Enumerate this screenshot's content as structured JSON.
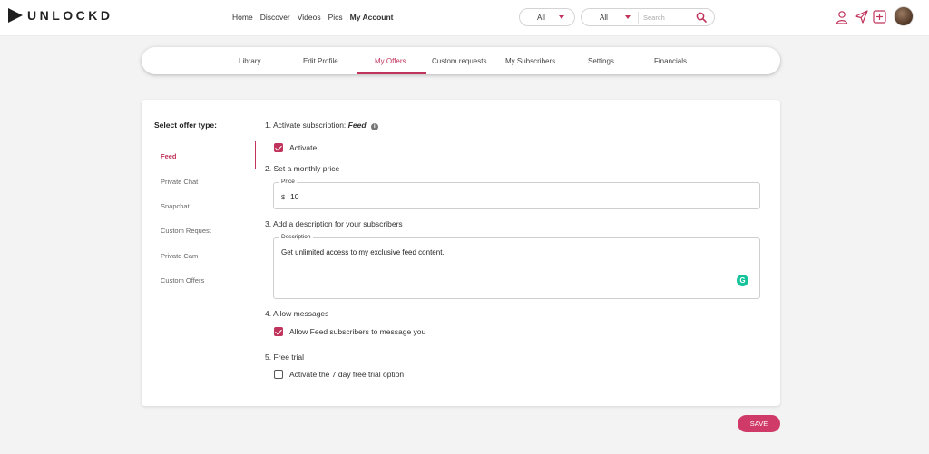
{
  "brand": {
    "name": "UNLOCKD",
    "accent": "#c0345c"
  },
  "nav": {
    "items": [
      {
        "label": "Home",
        "active": false
      },
      {
        "label": "Discover",
        "active": false
      },
      {
        "label": "Videos",
        "active": false
      },
      {
        "label": "Pics",
        "active": false
      },
      {
        "label": "My Account",
        "active": true
      }
    ]
  },
  "filters": {
    "first": {
      "value": "All"
    },
    "second": {
      "value": "All"
    },
    "search_placeholder": "Search"
  },
  "header_icons": [
    "user-icon",
    "send-icon",
    "add-icon",
    "avatar"
  ],
  "tabs": [
    {
      "label": "Library",
      "active": false
    },
    {
      "label": "Edit Profile",
      "active": false
    },
    {
      "label": "My Offers",
      "active": true
    },
    {
      "label": "Custom requests",
      "active": false
    },
    {
      "label": "My Subscribers",
      "active": false
    },
    {
      "label": "Settings",
      "active": false
    },
    {
      "label": "Financials",
      "active": false
    }
  ],
  "sidebar": {
    "title": "Select offer type:",
    "items": [
      {
        "label": "Feed",
        "active": true
      },
      {
        "label": "Private Chat",
        "active": false
      },
      {
        "label": "Snapchat",
        "active": false
      },
      {
        "label": "Custom Request",
        "active": false
      },
      {
        "label": "Private Cam",
        "active": false
      },
      {
        "label": "Custom Offers",
        "active": false
      }
    ]
  },
  "form": {
    "step1": {
      "label": "1. Activate subscription:",
      "offer_name": "Feed",
      "info_glyph": "i"
    },
    "activate": {
      "label": "Activate",
      "checked": true
    },
    "step2": {
      "label": "2. Set a monthly price"
    },
    "price": {
      "legend": "Price",
      "currency": "$",
      "value": "10"
    },
    "step3": {
      "label": "3. Add a description for your subscribers"
    },
    "description": {
      "legend": "Description",
      "value": "Get unlimited access to my exclusive feed content."
    },
    "step4": {
      "label": "4. Allow messages"
    },
    "allow_messages": {
      "label": "Allow Feed subscribers to message you",
      "checked": true
    },
    "step5": {
      "label": "5. Free trial"
    },
    "free_trial": {
      "label": "Activate the 7 day free trial option",
      "checked": false
    }
  },
  "grammar_badge": "G",
  "save_label": "SAVE"
}
